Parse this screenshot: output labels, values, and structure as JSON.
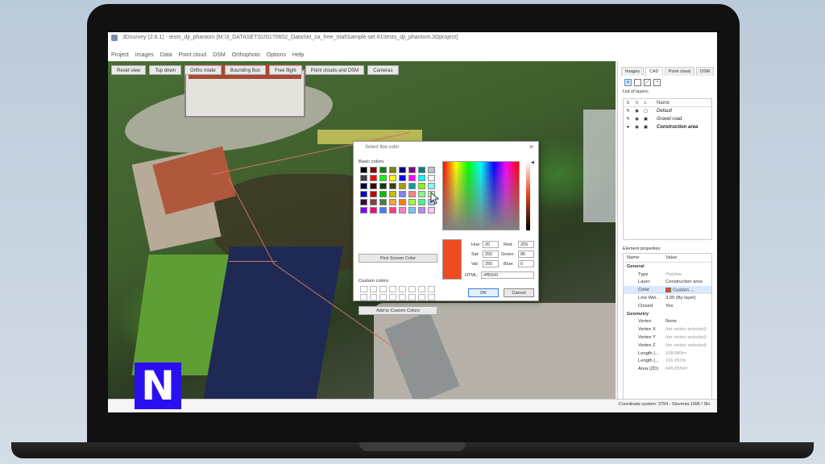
{
  "window": {
    "title": "3Dsurvey (2.6.1) - tests_dji_phantom [M:\\3_DATASETS\\20170602_DataSet_za_free_trial\\Sample set #1\\tests_dji_phantom.3Dproject]"
  },
  "menu": [
    "Project",
    "Images",
    "Data",
    "Point cloud",
    "DSM",
    "Orthophoto",
    "Options",
    "Help"
  ],
  "view_toolbar": [
    "Reset view",
    "Top down",
    "Ortho mode",
    "Bounding Box",
    "Free flight",
    "Point clouds and DSM",
    "Cameras"
  ],
  "right_tabs": [
    "Images",
    "CAD",
    "Point cloud",
    "DSM"
  ],
  "right_tab_active": "CAD",
  "list_of_layers_label": "List of layers:",
  "layer_headers": {
    "s": "S",
    "v": "V",
    "l": "L",
    "name": "Name"
  },
  "layers": [
    {
      "name": "Default",
      "bold": false
    },
    {
      "name": "Gravel road",
      "bold": false
    },
    {
      "name": "Construction area",
      "bold": true
    }
  ],
  "element_properties_label": "Element properties:",
  "prop_headers": {
    "name": "Name",
    "value": "Value"
  },
  "props": [
    {
      "key": "General",
      "value": "",
      "group": true
    },
    {
      "key": "Type",
      "value": "Polyline",
      "muted": true
    },
    {
      "key": "Layer",
      "value": "Construction area"
    },
    {
      "key": "Color",
      "value": "Custom ...",
      "selected": true,
      "swatch": "#ef4b20"
    },
    {
      "key": "Line Wei...",
      "value": "3.00 (By layer)"
    },
    {
      "key": "Closed",
      "value": "Yes"
    },
    {
      "key": "Geometry",
      "value": "",
      "group": true
    },
    {
      "key": "Vertex",
      "value": "None"
    },
    {
      "key": "Vertex X",
      "value": "(no vertex selected)",
      "muted": true
    },
    {
      "key": "Vertex Y",
      "value": "(no vertex selected)",
      "muted": true
    },
    {
      "key": "Vertex Z",
      "value": "(no vertex selected)",
      "muted": true
    },
    {
      "key": "Length (...",
      "value": "108.983m",
      "muted": true
    },
    {
      "key": "Length (...",
      "value": "116.057m",
      "muted": true
    },
    {
      "key": "Area (2D)",
      "value": "645.855m²",
      "muted": true
    }
  ],
  "status": {
    "coordinate_system": "Coordinate system: 3794 - Slovenia 1996 / Slo"
  },
  "dialog": {
    "title": "Select line color",
    "close_symbol": "✕",
    "basic_colors_label": "Basic colors",
    "basic_colors": [
      "#000000",
      "#800000",
      "#008000",
      "#808000",
      "#000080",
      "#800080",
      "#008080",
      "#c0c0c0",
      "#404040",
      "#ff0000",
      "#00ff00",
      "#ffff00",
      "#0000ff",
      "#ff00ff",
      "#00ffff",
      "#ffffff",
      "#000040",
      "#400000",
      "#004000",
      "#404000",
      "#a0a000",
      "#00a0a0",
      "#80ff00",
      "#80ffff",
      "#0000c0",
      "#c00000",
      "#00c000",
      "#c0c000",
      "#8080ff",
      "#ff8080",
      "#80ff80",
      "#c0ffc0",
      "#400040",
      "#804040",
      "#408040",
      "#ffa040",
      "#ff8000",
      "#a0ff40",
      "#40ff80",
      "#a0c0ff",
      "#8000ff",
      "#ff0080",
      "#4080ff",
      "#ff4080",
      "#ff80c0",
      "#80c0ff",
      "#c080ff",
      "#ffc0ff"
    ],
    "pick_screen_label": "Pick Screen Color",
    "custom_colors_label": "Custom colors",
    "add_custom_label": "Add to Custom Colors",
    "selected_color": "#ef4b20",
    "fields": {
      "hue_label": "Hue:",
      "hue": "20",
      "sat_label": "Sat:",
      "sat": "255",
      "val_label": "Val:",
      "val": "255",
      "red_label": "Red:",
      "red": "255",
      "green_label": "Green:",
      "green": "85",
      "blue_label": "Blue:",
      "blue": "0"
    },
    "html_label": "HTML:",
    "html_value": "#ff5500",
    "ok_label": "OK",
    "cancel_label": "Cancel"
  },
  "badge": "N"
}
